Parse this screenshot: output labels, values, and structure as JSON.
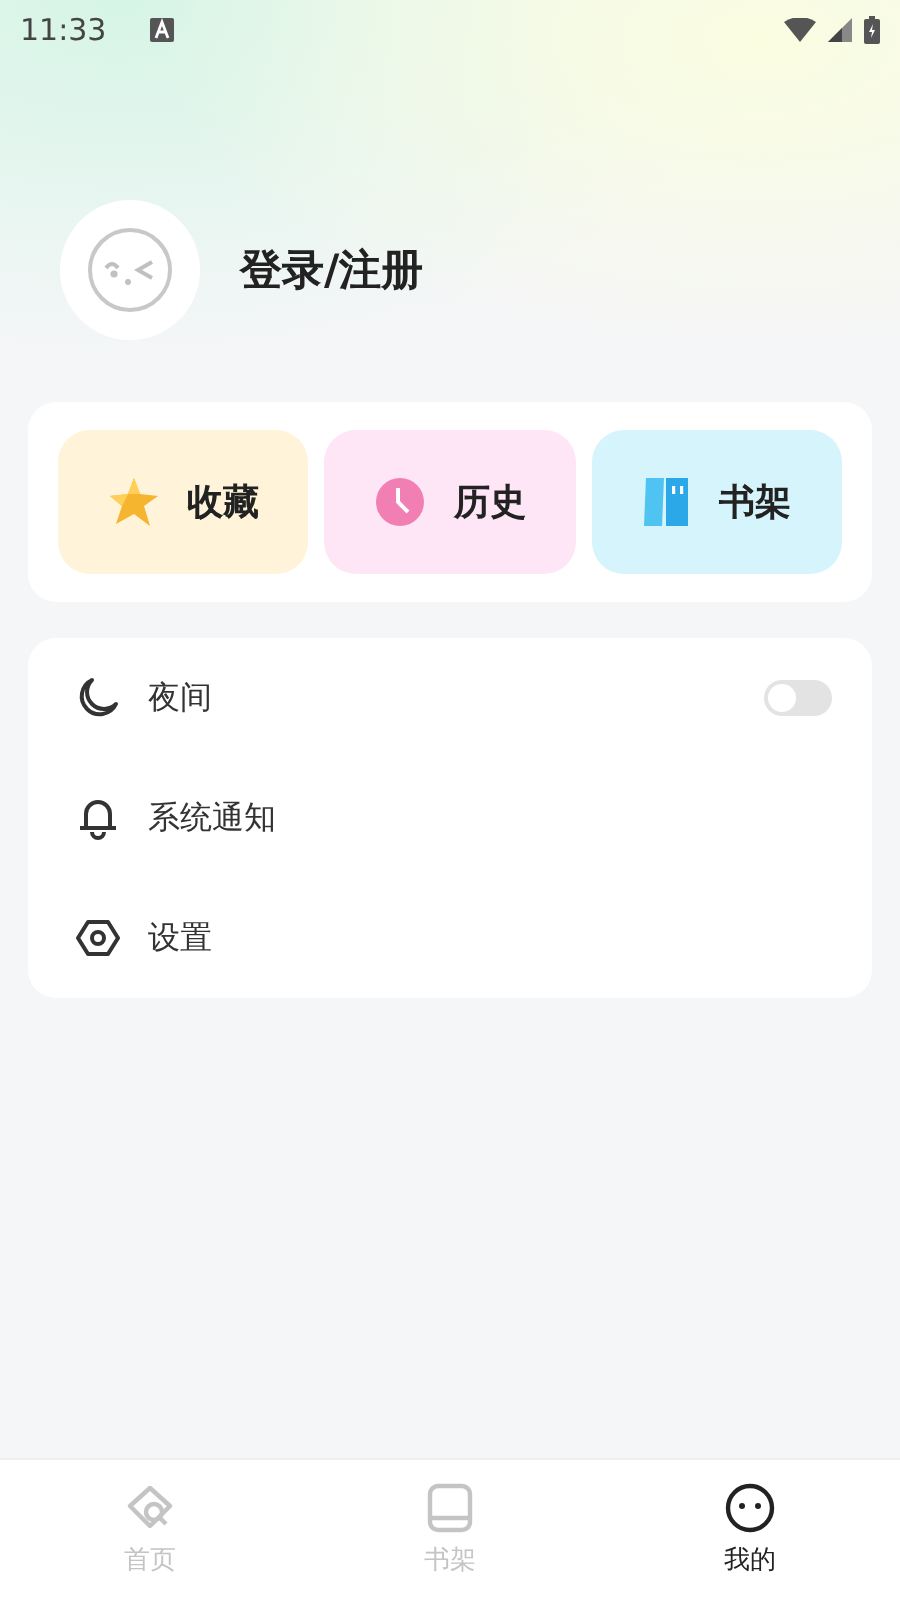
{
  "status_bar": {
    "time": "11:33"
  },
  "profile": {
    "login_label": "登录/注册"
  },
  "shortcuts": [
    {
      "kind": "favorites",
      "label": "收藏"
    },
    {
      "kind": "history",
      "label": "历史"
    },
    {
      "kind": "bookshelf",
      "label": "书架"
    }
  ],
  "settings": [
    {
      "kind": "night",
      "label": "夜间",
      "on": false
    },
    {
      "kind": "notify",
      "label": "系统通知"
    },
    {
      "kind": "settings",
      "label": "设置"
    }
  ],
  "tabs": [
    {
      "kind": "home",
      "label": "首页",
      "selected": false
    },
    {
      "kind": "shelf",
      "label": "书架",
      "selected": false
    },
    {
      "kind": "me",
      "label": "我的",
      "selected": true
    }
  ]
}
